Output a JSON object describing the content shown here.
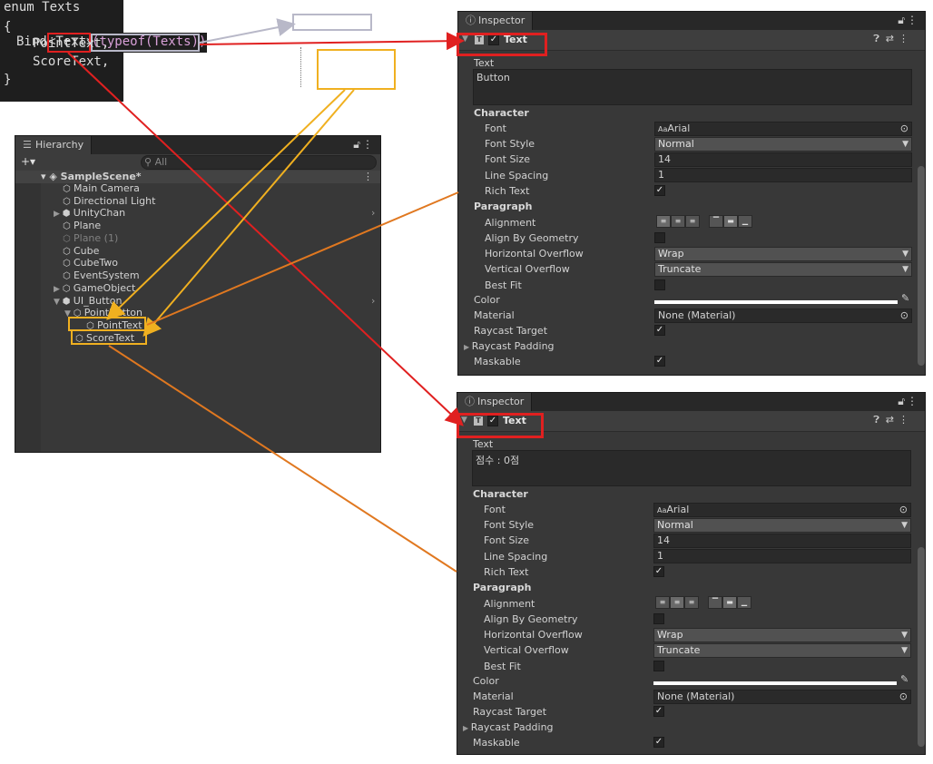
{
  "code": {
    "bind_prefix": "Bind",
    "bind_generic": "<Text>",
    "bind_arg": "(typeof(Texts))",
    "enum_header": "enum Texts",
    "open_brace": "{",
    "close_brace": "}",
    "enum_items": [
      "PointText,",
      "ScoreText,"
    ]
  },
  "hierarchy": {
    "tab_label": "Hierarchy",
    "add_label": "+▾",
    "search_placeholder": "All",
    "scene": "SampleScene*",
    "items": [
      {
        "label": "Main Camera"
      },
      {
        "label": "Directional Light"
      },
      {
        "label": "UnityChan"
      },
      {
        "label": "Plane"
      },
      {
        "label": "Plane (1)"
      },
      {
        "label": "Cube"
      },
      {
        "label": "CubeTwo"
      },
      {
        "label": "EventSystem"
      },
      {
        "label": "GameObject"
      },
      {
        "label": "UI_Button"
      },
      {
        "label": "PointButton"
      },
      {
        "label": "PointText"
      },
      {
        "label": "ScoreText"
      }
    ]
  },
  "inspectors": [
    {
      "tab_label": "Inspector",
      "component": "Text",
      "text_label": "Text",
      "text_value": "Button",
      "character": "Character",
      "font_label": "Font",
      "font_value": "Arial",
      "font_style_label": "Font Style",
      "font_style_value": "Normal",
      "font_size_label": "Font Size",
      "font_size_value": "14",
      "line_spacing_label": "Line Spacing",
      "line_spacing_value": "1",
      "rich_text_label": "Rich Text",
      "paragraph": "Paragraph",
      "alignment_label": "Alignment",
      "align_geometry_label": "Align By Geometry",
      "h_overflow_label": "Horizontal Overflow",
      "h_overflow_value": "Wrap",
      "v_overflow_label": "Vertical Overflow",
      "v_overflow_value": "Truncate",
      "best_fit_label": "Best Fit",
      "color_label": "Color",
      "material_label": "Material",
      "material_value": "None (Material)",
      "raycast_target_label": "Raycast Target",
      "raycast_padding_label": "Raycast Padding",
      "maskable_label": "Maskable",
      "font_prefix": "Aa"
    },
    {
      "tab_label": "Inspector",
      "component": "Text",
      "text_label": "Text",
      "text_value": "점수 : 0점",
      "character": "Character",
      "font_label": "Font",
      "font_value": "Arial",
      "font_style_label": "Font Style",
      "font_style_value": "Normal",
      "font_size_label": "Font Size",
      "font_size_value": "14",
      "line_spacing_label": "Line Spacing",
      "line_spacing_value": "1",
      "rich_text_label": "Rich Text",
      "paragraph": "Paragraph",
      "alignment_label": "Alignment",
      "align_geometry_label": "Align By Geometry",
      "h_overflow_label": "Horizontal Overflow",
      "h_overflow_value": "Wrap",
      "v_overflow_label": "Vertical Overflow",
      "v_overflow_value": "Truncate",
      "best_fit_label": "Best Fit",
      "color_label": "Color",
      "material_label": "Material",
      "material_value": "None (Material)",
      "raycast_target_label": "Raycast Target",
      "raycast_padding_label": "Raycast Padding",
      "maskable_label": "Maskable",
      "font_prefix": "Aa"
    }
  ],
  "colors": {
    "red_annotation": "#e02020",
    "yellow_annotation": "#f0b020",
    "orange_annotation": "#e07820",
    "gray_annotation": "#b8b8c8"
  }
}
